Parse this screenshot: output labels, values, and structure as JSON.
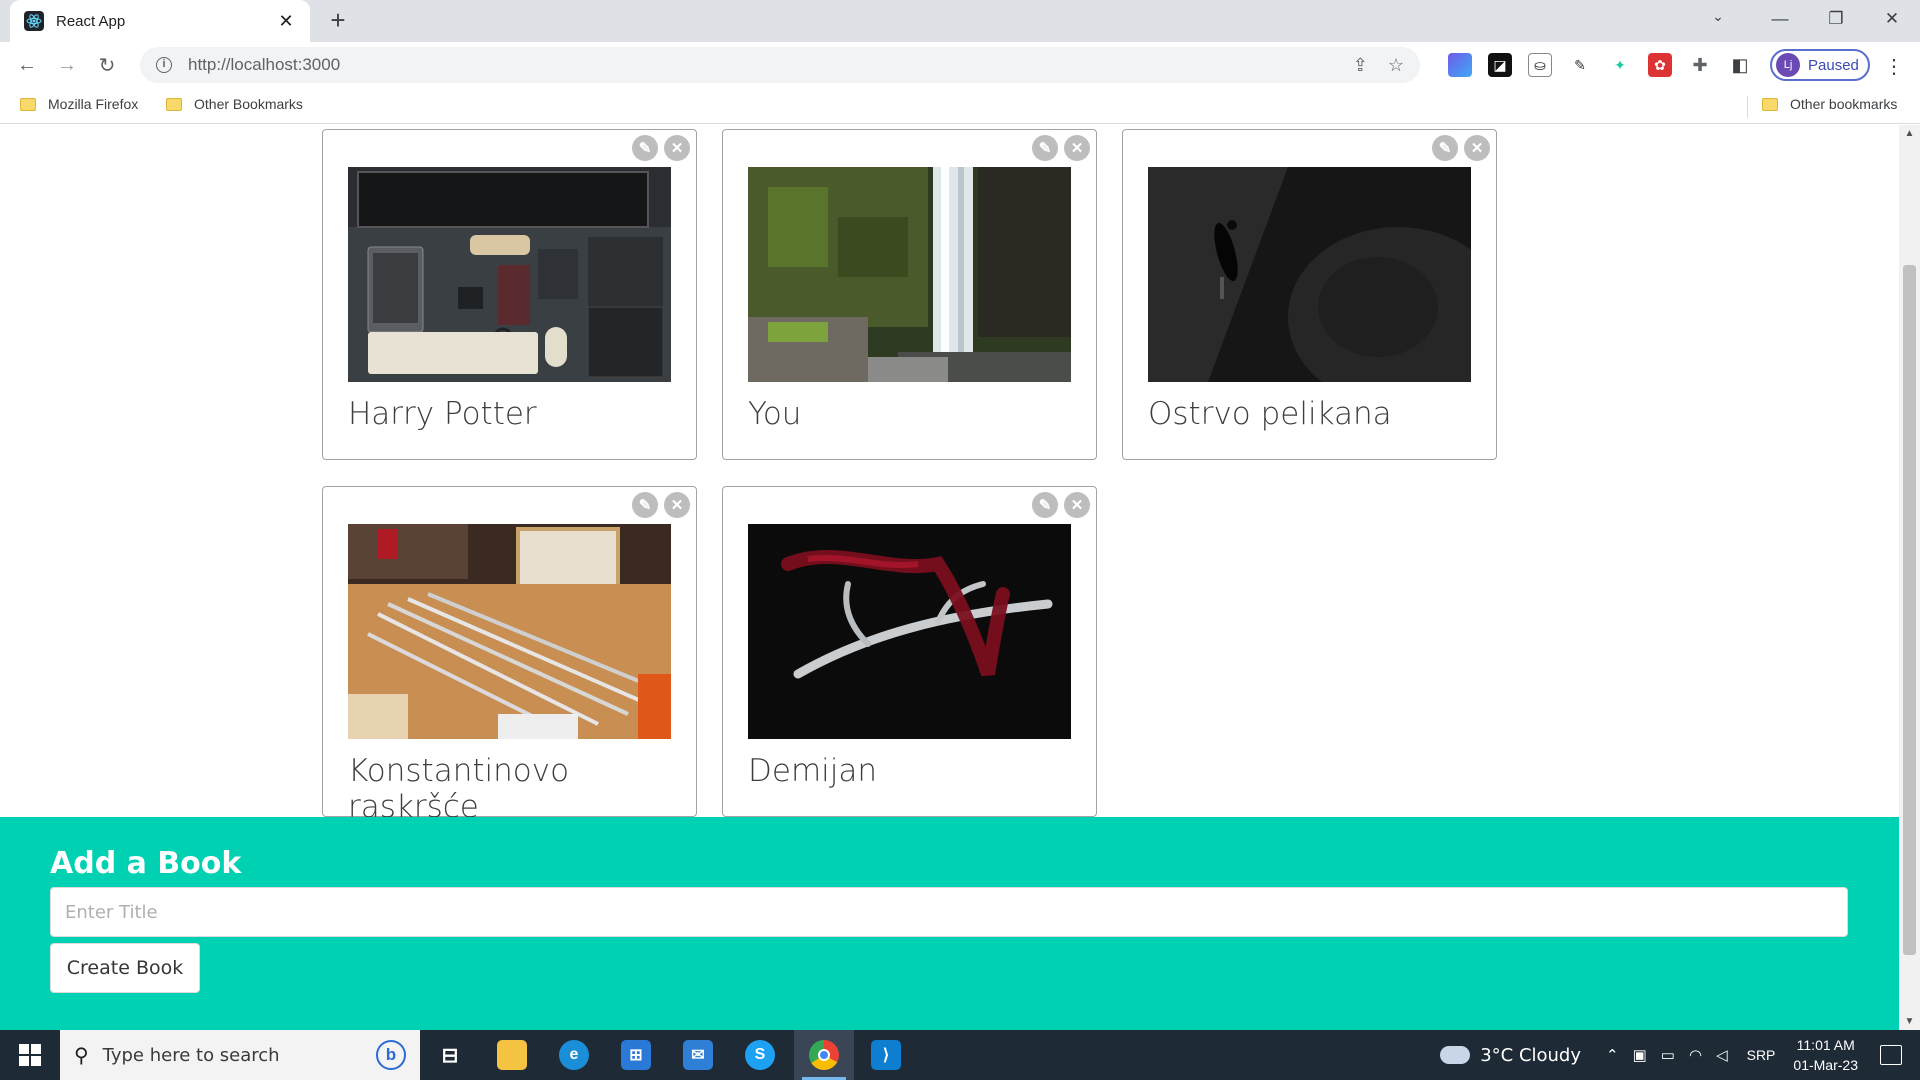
{
  "browser": {
    "tab_title": "React App",
    "url": "http://localhost:3000",
    "profile_initials": "Lj",
    "profile_status": "Paused",
    "bookmarks": [
      "Mozilla Firefox",
      "Other Bookmarks"
    ],
    "other_bookmarks": "Other bookmarks"
  },
  "books": [
    {
      "title": "Harry Potter",
      "image": "desk-setup"
    },
    {
      "title": "You",
      "image": "waterfall"
    },
    {
      "title": "Ostrvo pelikana",
      "image": "underwater-diver"
    },
    {
      "title": "Konstantinovo raskršće",
      "image": "pens-on-desk"
    },
    {
      "title": "Demijan",
      "image": "antler-red-ribbon"
    }
  ],
  "create": {
    "heading": "Add a Book",
    "placeholder": "Enter Title",
    "button_label": "Create Book"
  },
  "taskbar": {
    "search_placeholder": "Type here to search",
    "weather": "3°C  Cloudy",
    "language": "SRP",
    "time": "11:01 AM",
    "date": "01-Mar-23"
  }
}
